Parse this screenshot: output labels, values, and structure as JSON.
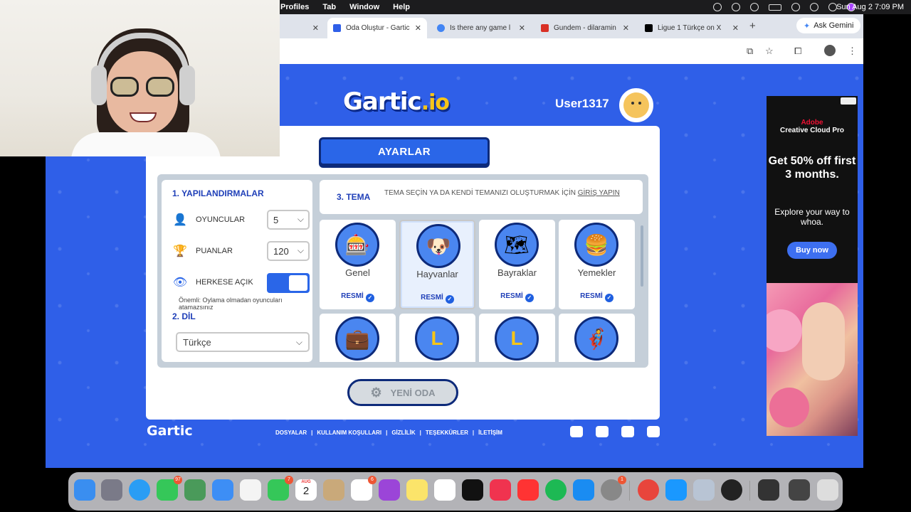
{
  "menubar": {
    "items": [
      "Profiles",
      "Tab",
      "Window",
      "Help"
    ],
    "clock": "Sun Aug 2  7:09 PM"
  },
  "tabs": [
    {
      "title": "s",
      "fav": "#aaa",
      "close": "✕"
    },
    {
      "title": "Oda Oluştur - Gartic",
      "fav": "#2f5fe8",
      "close": "✕"
    },
    {
      "title": "Is there any game l",
      "fav": "#4285f4",
      "close": "✕"
    },
    {
      "title": "Gundem - dilaramin",
      "fav": "#d93025",
      "close": "✕"
    },
    {
      "title": "Ligue 1 Türkçe on X",
      "fav": "#000000",
      "close": "✕"
    }
  ],
  "browser": {
    "new_tab": "+",
    "gemini": "Ask Gemini",
    "menu": "⋮"
  },
  "header": {
    "logo_main": "Gartic",
    "logo_io": ".io",
    "username": "User1317"
  },
  "settings": {
    "title": "AYARLAR",
    "config_title": "1. YAPILANDIRMALAR",
    "players_label": "OYUNCULAR",
    "players_value": "5",
    "points_label": "PUANLAR",
    "points_value": "120",
    "public_label": "HERKESE AÇIK",
    "note": "Önemli: Oylama olmadan oyuncuları atamazsınız",
    "language_title": "2. DİL",
    "language_value": "Türkçe",
    "theme_title": "3. TEMA",
    "theme_desc": "TEMA SEÇİN YA DA KENDİ TEMANIZI OLUŞTURMAK İÇİN ",
    "theme_link": "GİRİŞ YAPIN"
  },
  "themes": [
    {
      "name": "Genel",
      "official": "RESMİ",
      "icon": "🎰",
      "color": "#4a86f0"
    },
    {
      "name": "Hayvanlar",
      "official": "RESMİ",
      "icon": "🐶",
      "color": "#4a86f0"
    },
    {
      "name": "Bayraklar",
      "official": "RESMİ",
      "icon": "🗺",
      "color": "#4a86f0"
    },
    {
      "name": "Yemekler",
      "official": "RESMİ",
      "icon": "🍔",
      "color": "#4a86f0"
    },
    {
      "name": "",
      "official": "",
      "icon": "💼",
      "color": "#4a86f0"
    },
    {
      "name": "",
      "official": "",
      "icon": "L",
      "color": "#4a86f0"
    },
    {
      "name": "",
      "official": "",
      "icon": "L",
      "color": "#4a86f0"
    },
    {
      "name": "",
      "official": "",
      "icon": "🦸",
      "color": "#4a86f0"
    }
  ],
  "new_room": "YENİ ODA",
  "footer": {
    "logo": "Gartic",
    "links": [
      "DOSYALAR",
      "|",
      "KULLANIM KOŞULLARI",
      "|",
      "GİZLİLİK",
      "|",
      "TEŞEKKÜRLER",
      "|",
      "İLETİŞİM"
    ]
  },
  "ad": {
    "brand_top": "Adobe",
    "brand": "Creative Cloud Pro",
    "headline": "Get 50% off first 3 months.",
    "sub": "Explore your way to whoa.",
    "cta": "Buy now"
  },
  "dock": {
    "calendar_month": "AUG",
    "calendar_day": "2",
    "badges": [
      "97",
      "7",
      "6",
      "1"
    ]
  },
  "colors": {
    "page_bg": "#2f5fe8",
    "accent": "#1f3fb8",
    "dark_outline": "#0d2a7a"
  }
}
